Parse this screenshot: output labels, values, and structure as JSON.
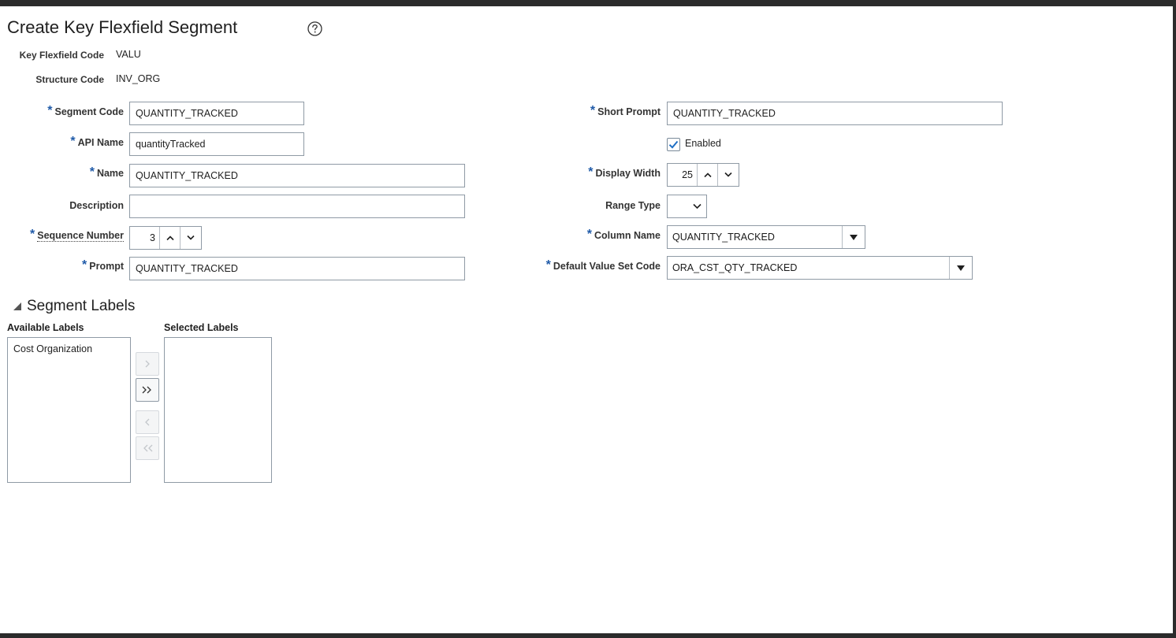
{
  "page": {
    "title": "Create Key Flexfield Segment"
  },
  "readonly": {
    "key_flexfield_code_label": "Key Flexfield Code",
    "key_flexfield_code_value": "VALU",
    "structure_code_label": "Structure Code",
    "structure_code_value": "INV_ORG"
  },
  "required_marker": "*",
  "form_left": {
    "segment_code": {
      "label": "Segment Code",
      "value": "QUANTITY_TRACKED"
    },
    "api_name": {
      "label": "API Name",
      "value": "quantityTracked"
    },
    "name": {
      "label": "Name",
      "value": "QUANTITY_TRACKED"
    },
    "description": {
      "label": "Description",
      "value": ""
    },
    "sequence_number": {
      "label": "Sequence Number",
      "value": "3"
    },
    "prompt": {
      "label": "Prompt",
      "value": "QUANTITY_TRACKED"
    }
  },
  "form_right": {
    "short_prompt": {
      "label": "Short Prompt",
      "value": "QUANTITY_TRACKED"
    },
    "enabled": {
      "label": "Enabled",
      "checked": true
    },
    "display_width": {
      "label": "Display Width",
      "value": "25"
    },
    "range_type": {
      "label": "Range Type",
      "value": ""
    },
    "column_name": {
      "label": "Column Name",
      "value": "QUANTITY_TRACKED"
    },
    "default_value_set_code": {
      "label": "Default Value Set Code",
      "value": "ORA_CST_QTY_TRACKED"
    }
  },
  "segment_labels": {
    "section_title": "Segment Labels",
    "available_header": "Available Labels",
    "selected_header": "Selected Labels",
    "available_items": [
      "Cost Organization"
    ],
    "selected_items": []
  },
  "colors": {
    "required_star": "#1f5aa8",
    "checkbox_check": "#1f6fc5",
    "frame": "#2b2b2b"
  },
  "icons": {
    "help": "help-circle-icon",
    "collapse": "triangle-down-icon",
    "move": "chevron-right-icon",
    "move_all": "double-chevron-right-icon",
    "remove": "chevron-left-icon",
    "remove_all": "double-chevron-left-icon"
  }
}
